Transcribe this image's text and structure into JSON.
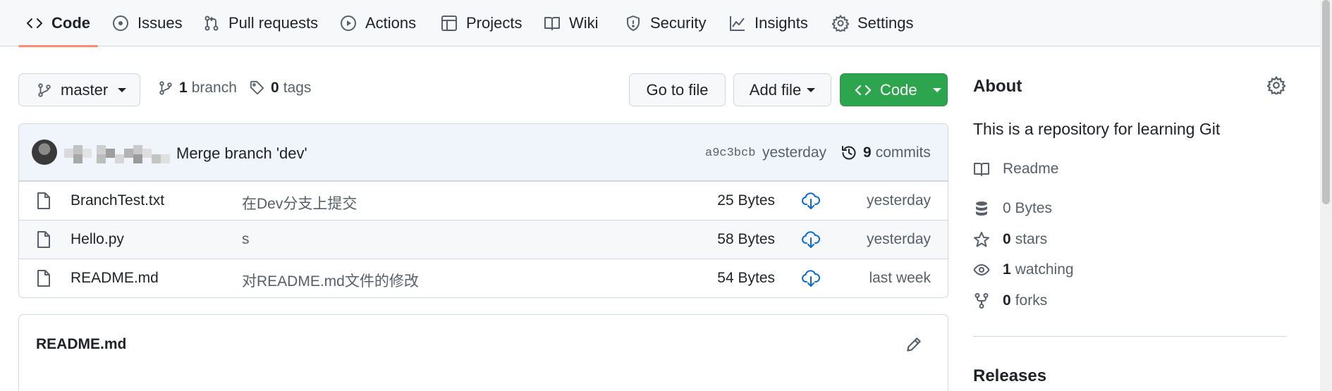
{
  "nav": {
    "tabs": [
      {
        "label": "Code",
        "icon": "code-icon",
        "active": true
      },
      {
        "label": "Issues",
        "icon": "issue-circle-icon"
      },
      {
        "label": "Pull requests",
        "icon": "pull-request-icon"
      },
      {
        "label": "Actions",
        "icon": "play-icon"
      },
      {
        "label": "Projects",
        "icon": "table-icon"
      },
      {
        "label": "Wiki",
        "icon": "book-icon"
      },
      {
        "label": "Security",
        "icon": "shield-icon"
      },
      {
        "label": "Insights",
        "icon": "graph-icon"
      },
      {
        "label": "Settings",
        "icon": "gear-icon"
      }
    ]
  },
  "toolbar": {
    "branch_select": "master",
    "branch_count": "1",
    "branch_label": "branch",
    "tag_count": "0",
    "tag_label": "tags",
    "go_to_file": "Go to file",
    "add_file": "Add file",
    "code_button": "Code"
  },
  "commit": {
    "message": "Merge branch 'dev'",
    "sha": "a9c3bcb",
    "time": "yesterday",
    "count": "9",
    "count_label": "commits"
  },
  "files": [
    {
      "name": "BranchTest.txt",
      "message": "在Dev分支上提交",
      "size": "25 Bytes",
      "age": "yesterday"
    },
    {
      "name": "Hello.py",
      "message": "s",
      "size": "58 Bytes",
      "age": "yesterday"
    },
    {
      "name": "README.md",
      "message": "对README.md文件的修改",
      "size": "54 Bytes",
      "age": "last week"
    }
  ],
  "readme": {
    "title": "README.md"
  },
  "about": {
    "title": "About",
    "description": "This is a repository for learning Git",
    "readme_label": "Readme",
    "size_label": "0 Bytes",
    "stars_count": "0",
    "stars_label": "stars",
    "watching_count": "1",
    "watching_label": "watching",
    "forks_count": "0",
    "forks_label": "forks",
    "releases_title": "Releases"
  },
  "colors": {
    "accent_green": "#2da44e",
    "active_tab_underline": "#fd8c73",
    "link_blue": "#0969da"
  }
}
